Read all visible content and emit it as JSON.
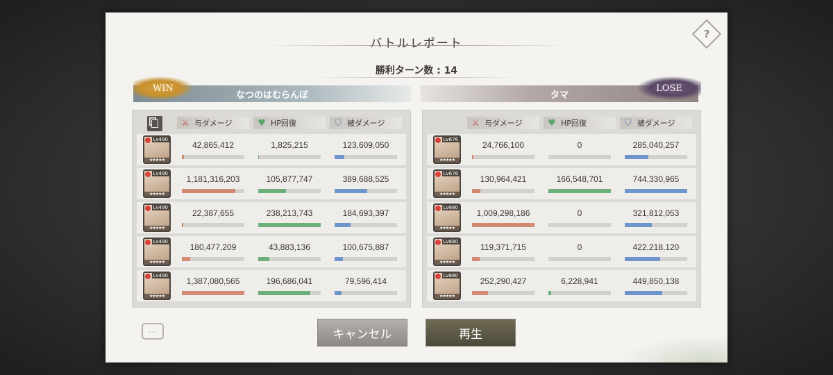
{
  "dialog": {
    "title": "バトルレポート",
    "turns_label": "勝利ターン数 : 14",
    "buttons": {
      "cancel": "キャンセル",
      "play": "再生"
    }
  },
  "columns": {
    "damage": "与ダメージ",
    "heal": "HP回復",
    "taken": "被ダメージ"
  },
  "left_team": {
    "result": "WIN",
    "name": "なつのはむらんぼ",
    "rows": [
      {
        "level": "Lv490",
        "damage": "42,865,412",
        "heal": "1,825,215",
        "taken": "123,609,050",
        "damage_ratio": 0.03,
        "heal_ratio": 0.01,
        "taken_ratio": 0.16
      },
      {
        "level": "Lv490",
        "damage": "1,181,316,203",
        "heal": "105,877,747",
        "taken": "389,688,525",
        "damage_ratio": 0.85,
        "heal_ratio": 0.44,
        "taken_ratio": 0.52
      },
      {
        "level": "Lv490",
        "damage": "22,387,655",
        "heal": "238,213,743",
        "taken": "184,693,397",
        "damage_ratio": 0.02,
        "heal_ratio": 1.0,
        "taken_ratio": 0.25
      },
      {
        "level": "Lv490",
        "damage": "180,477,209",
        "heal": "43,883,136",
        "taken": "100,675,887",
        "damage_ratio": 0.13,
        "heal_ratio": 0.18,
        "taken_ratio": 0.13
      },
      {
        "level": "Lv490",
        "damage": "1,387,080,565",
        "heal": "196,686,041",
        "taken": "79,596,414",
        "damage_ratio": 1.0,
        "heal_ratio": 0.83,
        "taken_ratio": 0.11
      }
    ]
  },
  "right_team": {
    "result": "LOSE",
    "name": "タマ",
    "rows": [
      {
        "level": "Lv676",
        "damage": "24,766,100",
        "heal": "0",
        "taken": "285,040,257",
        "damage_ratio": 0.02,
        "heal_ratio": 0.0,
        "taken_ratio": 0.38
      },
      {
        "level": "Lv676",
        "damage": "130,964,421",
        "heal": "166,548,701",
        "taken": "744,330,965",
        "damage_ratio": 0.13,
        "heal_ratio": 1.0,
        "taken_ratio": 1.0
      },
      {
        "level": "Lv680",
        "damage": "1,009,298,186",
        "heal": "0",
        "taken": "321,812,053",
        "damage_ratio": 1.0,
        "heal_ratio": 0.0,
        "taken_ratio": 0.43
      },
      {
        "level": "Lv680",
        "damage": "119,371,715",
        "heal": "0",
        "taken": "422,218,120",
        "damage_ratio": 0.12,
        "heal_ratio": 0.0,
        "taken_ratio": 0.57
      },
      {
        "level": "Lv680",
        "damage": "252,290,427",
        "heal": "6,228,941",
        "taken": "449,850,138",
        "damage_ratio": 0.25,
        "heal_ratio": 0.04,
        "taken_ratio": 0.6
      }
    ]
  },
  "colors": {
    "damage_bar": "#d48a72",
    "heal_bar": "#6bb07a",
    "taken_bar": "#6f96cc",
    "win": "#c6902e",
    "lose": "#5a4766"
  },
  "icons": {
    "damage": "sword-icon",
    "heal": "heart-icon",
    "taken": "shield-icon",
    "help": "help-icon",
    "copy": "copy-icon",
    "chat": "chat-icon"
  }
}
